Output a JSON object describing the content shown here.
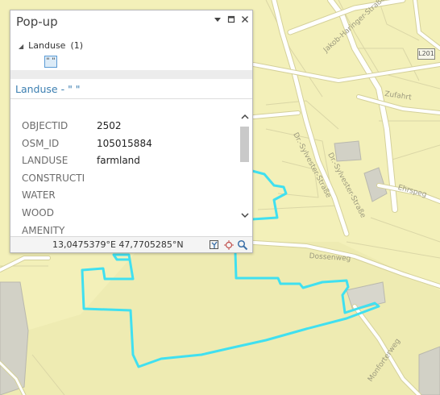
{
  "map": {
    "street_labels": [
      "Jakob-Haringer-Straße",
      "Zufahrt",
      "Dr.-Sylvester-Straße",
      "Dr.-Sylvester-Straße",
      "Ehrspeg",
      "Dossenweg",
      "Monforterweg"
    ],
    "road_badge": "L201",
    "colors": {
      "base": "#f3f0b9",
      "roads": "#ffffff",
      "road_outline": "#d4d09a",
      "parcel_lines": "#d9d5a6",
      "selection": "#40e0f0",
      "gray_area": "#cfcfc7",
      "lower_area": "#eceab4"
    }
  },
  "popup": {
    "title": "Pop-up",
    "controls": {
      "menu_icon": "chevron-down-icon",
      "restore_icon": "restore-window-icon",
      "close_icon": "close-icon"
    },
    "tree": {
      "layer": "Landuse",
      "count": "(1)",
      "selected_feature": "\" \""
    },
    "layer_title": "Landuse - \" \"",
    "fields": [
      {
        "name": "OBJECTID",
        "value": "2502"
      },
      {
        "name": "OSM_ID",
        "value": "105015884"
      },
      {
        "name": "LANDUSE",
        "value": "farmland"
      },
      {
        "name": "CONSTRUCTI",
        "value": ""
      },
      {
        "name": "WATER",
        "value": ""
      },
      {
        "name": "WOOD",
        "value": ""
      },
      {
        "name": "AMENITY",
        "value": ""
      }
    ],
    "coordinates": "13,0475379°E 47,7705285°N",
    "status_icons": [
      "flash-feature-icon",
      "zoom-to-feature-icon",
      "search-icon"
    ]
  }
}
